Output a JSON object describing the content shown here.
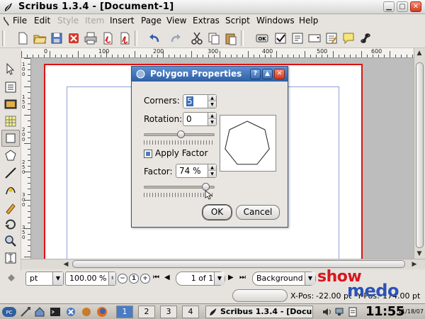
{
  "window": {
    "title": "Scribus 1.3.4 - [Document-1]",
    "buttons": [
      "minimize",
      "maximize",
      "close"
    ]
  },
  "menubar": {
    "items": [
      {
        "label": "File",
        "enabled": true
      },
      {
        "label": "Edit",
        "enabled": true
      },
      {
        "label": "Style",
        "enabled": false
      },
      {
        "label": "Item",
        "enabled": false
      },
      {
        "label": "Insert",
        "enabled": true
      },
      {
        "label": "Page",
        "enabled": true
      },
      {
        "label": "View",
        "enabled": true
      },
      {
        "label": "Extras",
        "enabled": true
      },
      {
        "label": "Script",
        "enabled": true
      },
      {
        "label": "Windows",
        "enabled": true
      },
      {
        "label": "Help",
        "enabled": true
      }
    ]
  },
  "toolbar": {
    "icons": [
      "new-document",
      "open",
      "save",
      "close-document",
      "print",
      "export-pdf",
      "undo",
      "redo",
      "cut",
      "copy",
      "paste",
      "preflight",
      "checkmark",
      "story-editor",
      "link-frames"
    ]
  },
  "ruler": {
    "horizontal_labels": [
      "0",
      "100",
      "200",
      "300",
      "400",
      "500",
      "600"
    ],
    "vertical_labels": [
      "100",
      "150",
      "200",
      "250",
      "300",
      "350"
    ]
  },
  "tools": [
    "select",
    "text-frame",
    "image-frame",
    "table",
    "shape",
    "polygon",
    "line",
    "bezier",
    "freehand",
    "rotate",
    "zoom",
    "edit-text",
    "measure",
    "copy-properties",
    "eyedropper"
  ],
  "dialog": {
    "title": "Polygon Properties",
    "corners_label": "Corners:",
    "corners_value": "5",
    "rotation_label": "Rotation:",
    "rotation_value": "0",
    "apply_factor_label": "Apply Factor",
    "apply_factor_checked": true,
    "factor_label": "Factor:",
    "factor_value": "74 %",
    "ok_label": "OK",
    "cancel_label": "Cancel",
    "rotation_slider_fraction": 0.52,
    "factor_slider_fraction": 0.87,
    "preview_shape": "heptagon"
  },
  "statusbar": {
    "unit": "pt",
    "zoom": "100.00 %",
    "page": "1 of 1",
    "layer": "Background",
    "xpos_label": "X-Pos:",
    "xpos_value": "-22.00 pt",
    "ypos_label": "Y-Pos:",
    "ypos_value": "174.00 pt"
  },
  "taskbar": {
    "desktops": [
      "1",
      "2",
      "3",
      "4"
    ],
    "active_desktop": "1",
    "task_label": "Scribus 1.3.4 - [Docu",
    "clock": "11:55",
    "date": "11/18/07"
  },
  "watermark": {
    "line1": "show",
    "line2": "medo"
  },
  "colors": {
    "page_border": "#dd1111",
    "margin_guide": "#8fa0d8",
    "dialog_title": "#3a6cb3",
    "watermark_red": "#d8161f",
    "watermark_blue": "#2b52b6"
  }
}
